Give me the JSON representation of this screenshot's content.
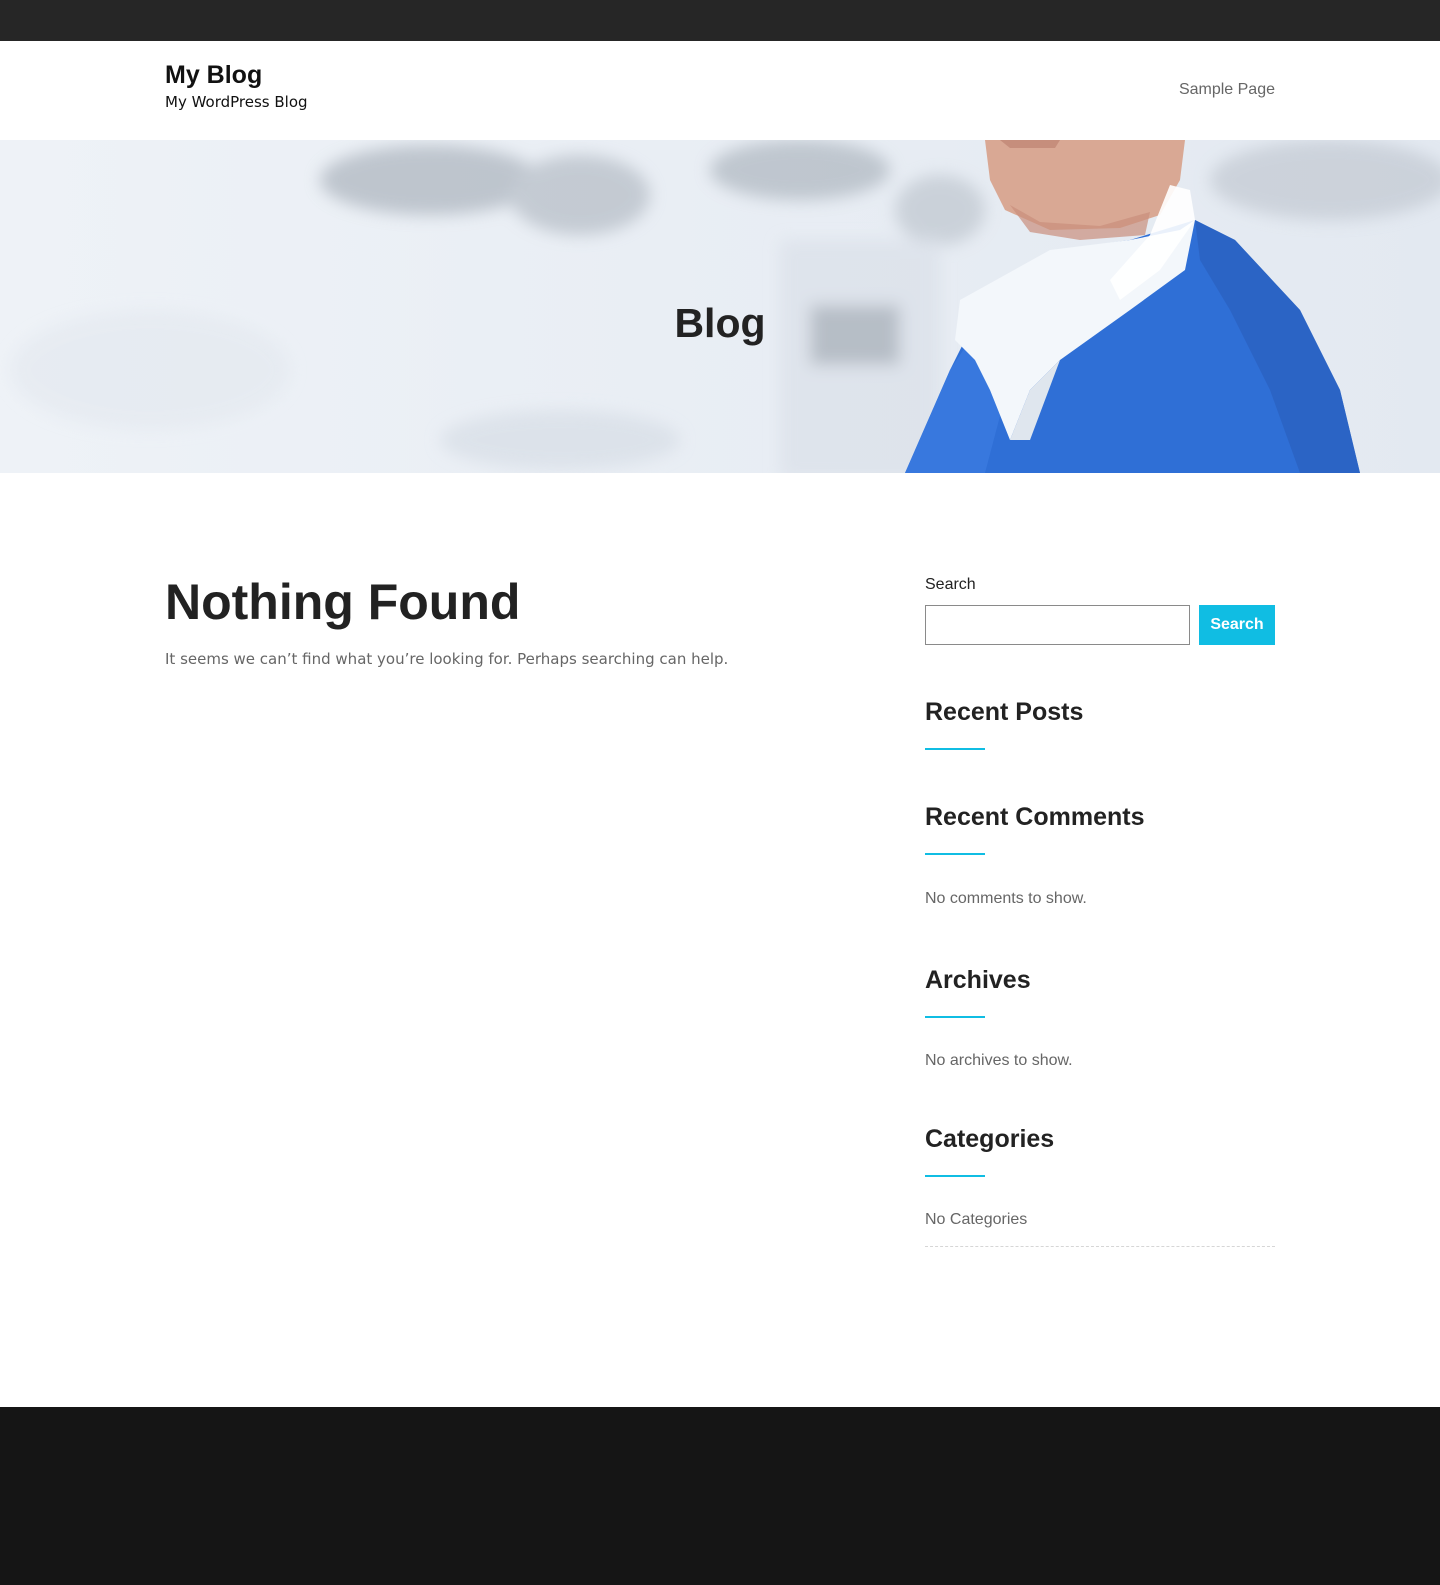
{
  "header": {
    "site_title": "My Blog",
    "tagline": "My WordPress Blog",
    "nav": [
      {
        "label": "Sample Page"
      }
    ]
  },
  "hero": {
    "title": "Blog"
  },
  "main": {
    "heading": "Nothing Found",
    "text": "It seems we can’t find what you’re looking for. Perhaps searching can help."
  },
  "sidebar": {
    "search": {
      "label": "Search",
      "value": "",
      "button_label": "Search"
    },
    "widgets": [
      {
        "title": "Recent Posts",
        "text": ""
      },
      {
        "title": "Recent Comments",
        "text": "No comments to show."
      },
      {
        "title": "Archives",
        "text": "No archives to show."
      },
      {
        "title": "Categories",
        "text": "No Categories"
      }
    ]
  },
  "colors": {
    "accent": "#10bde3",
    "topbar": "#262626",
    "footer": "#151515",
    "scrubs": "#2f6fd6"
  }
}
